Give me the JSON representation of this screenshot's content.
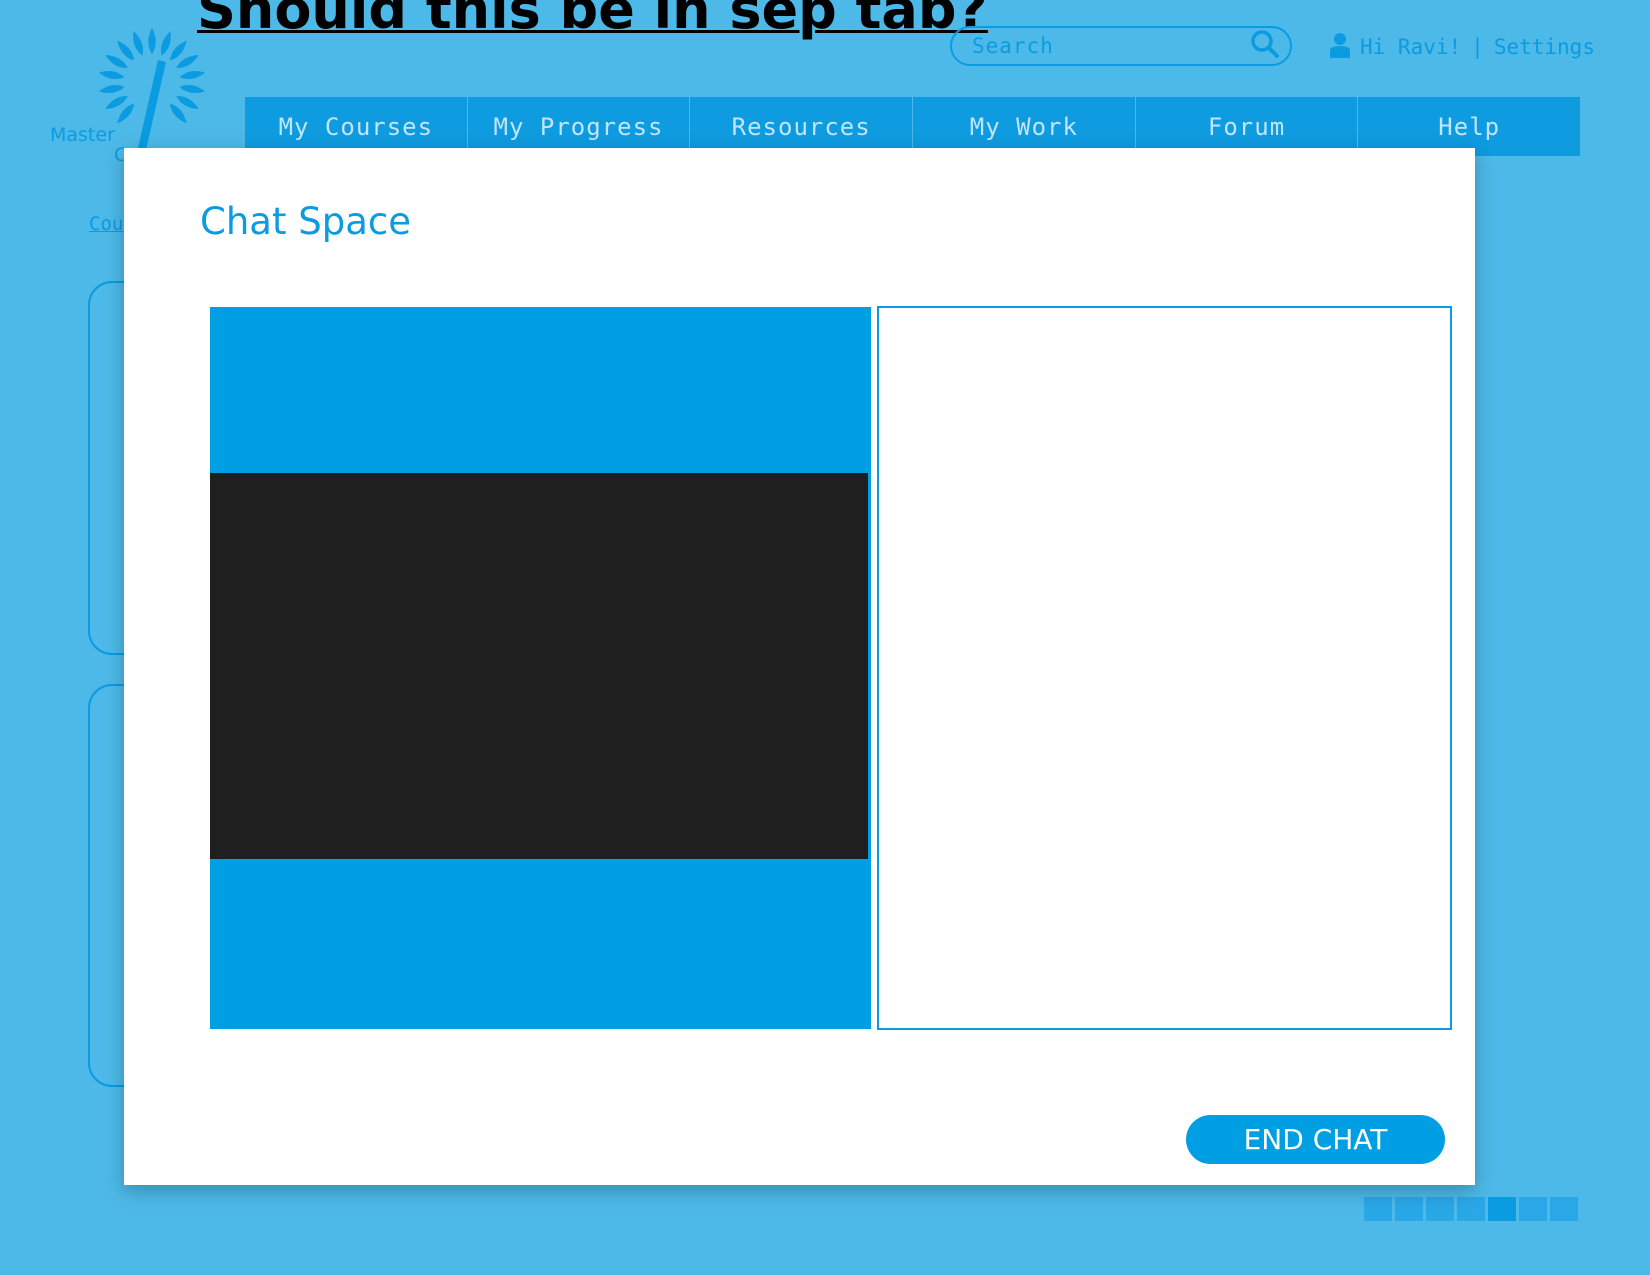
{
  "annotation": {
    "text": "Should this be in sep tab?"
  },
  "logo": {
    "line1": "Master",
    "line2": "C"
  },
  "search": {
    "placeholder": "Search"
  },
  "user": {
    "greeting": "Hi Ravi!",
    "separator": "|",
    "settings_label": "Settings"
  },
  "nav": {
    "items": [
      "My Courses",
      "My Progress",
      "Resources",
      "My Work",
      "Forum",
      "Help"
    ]
  },
  "breadcrumb": {
    "text": "Cou"
  },
  "modal": {
    "title": "Chat Space",
    "end_button_label": "END CHAT"
  },
  "pager": {
    "count": 7,
    "active_index": 4
  },
  "colors": {
    "page_background": "#4db9e8",
    "accent": "#0a9be0",
    "video_background": "#009fe3",
    "video_frame": "#1f1f1f",
    "modal_background": "#ffffff"
  },
  "icons": {
    "search": "magnifier-icon",
    "user": "person-icon",
    "logo": "sunburst-logo"
  }
}
